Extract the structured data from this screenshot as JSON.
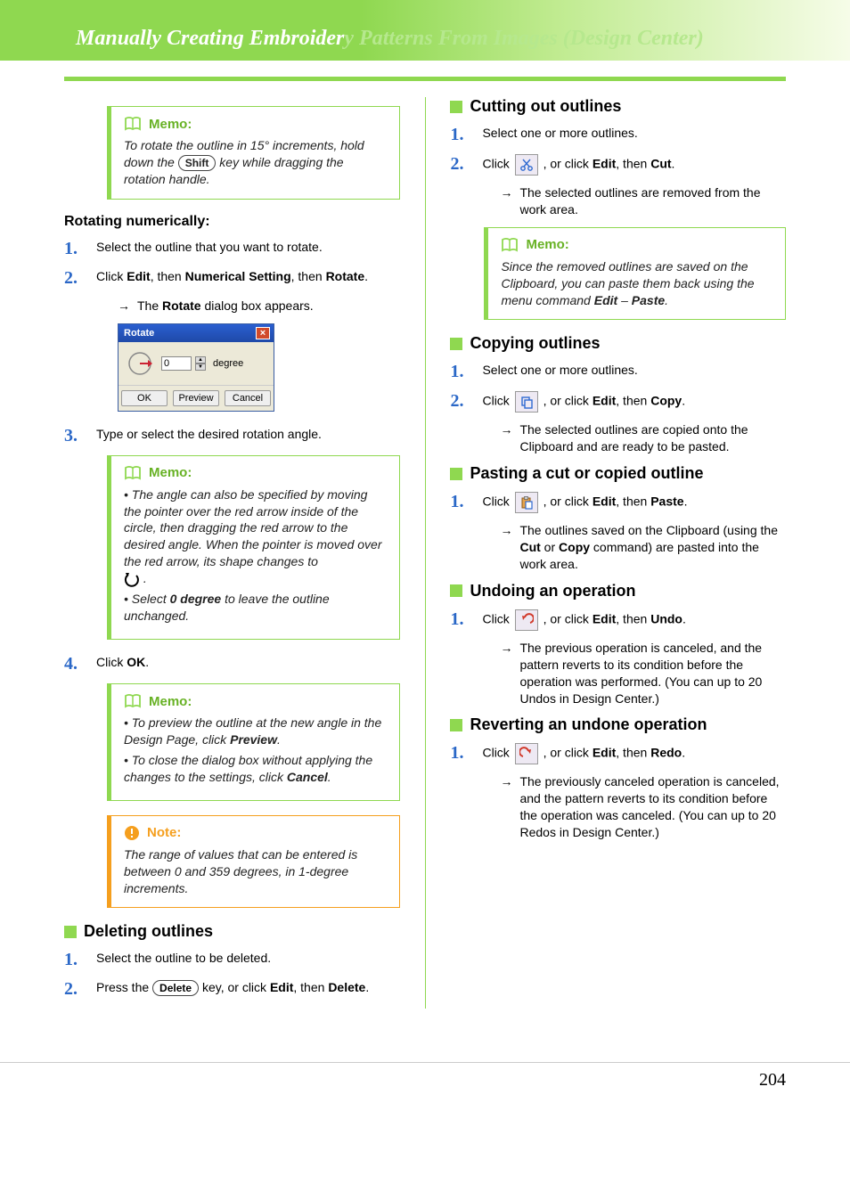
{
  "header": {
    "title_white": "Manually Creating Embroider",
    "title_fade": "y Patterns From Images (Design Center)"
  },
  "left": {
    "memo1": {
      "label": "Memo:",
      "text_a": "To rotate the outline in 15° increments, hold down the ",
      "shift": "Shift",
      "text_b": " key while dragging the rotation handle."
    },
    "rotnum_heading": "Rotating numerically:",
    "step1": "Select the outline that you want to rotate.",
    "step2_a": "Click ",
    "step2_edit": "Edit",
    "step2_b": ", then ",
    "step2_ns": "Numerical Setting",
    "step2_c": ", then ",
    "step2_rot": "Rotate",
    "step2_d": ".",
    "result2_a": "The ",
    "result2_b": "Rotate",
    "result2_c": " dialog box appears.",
    "dialog": {
      "title": "Rotate",
      "value": "0",
      "unit": "degree",
      "ok": "OK",
      "preview": "Preview",
      "cancel": "Cancel"
    },
    "step3": "Type or select the desired rotation angle.",
    "memo2": {
      "label": "Memo:",
      "li1": "The angle can also be specified by moving the pointer over the red arrow inside of the circle, then dragging the red arrow to the desired angle. When the pointer is moved over the red arrow, its shape changes to",
      "li1_suffix": ".",
      "li2_a": "Select ",
      "li2_b": "0 degree",
      "li2_c": " to leave the outline unchanged."
    },
    "step4_a": "Click ",
    "step4_b": "OK",
    "step4_c": ".",
    "memo3": {
      "label": "Memo:",
      "li1_a": "To preview the outline at the new angle in the Design Page, click ",
      "li1_b": "Preview",
      "li1_c": ".",
      "li2_a": "To close the dialog box without applying the changes to the settings, click ",
      "li2_b": "Cancel",
      "li2_c": "."
    },
    "note": {
      "label": "Note:",
      "text": "The range of values that can be entered is between 0 and 359 degrees, in 1-degree increments."
    },
    "del_heading": "Deleting outlines",
    "del_step1": "Select the outline to be deleted.",
    "del_step2_a": "Press the ",
    "del_step2_key": "Delete",
    "del_step2_b": " key, or click ",
    "del_step2_edit": "Edit",
    "del_step2_c": ", then ",
    "del_step2_del": "Delete",
    "del_step2_d": "."
  },
  "right": {
    "cut_heading": "Cutting out outlines",
    "cut_step1": "Select one or more outlines.",
    "cut_step2_a": "Click ",
    "cut_step2_b": " , or click ",
    "cut_step2_edit": "Edit",
    "cut_step2_c": ", then ",
    "cut_step2_cut": "Cut",
    "cut_step2_d": ".",
    "cut_result": "The selected outlines are removed from the work area.",
    "cut_memo": {
      "label": "Memo:",
      "text_a": "Since the removed outlines are saved on the Clipboard, you can paste them back using the menu command ",
      "edit": "Edit",
      "dash": " – ",
      "paste": "Paste",
      "text_b": "."
    },
    "copy_heading": "Copying outlines",
    "copy_step1": "Select one or more outlines.",
    "copy_step2_a": "Click ",
    "copy_step2_b": " , or click ",
    "copy_step2_edit": "Edit",
    "copy_step2_c": ", then ",
    "copy_step2_copy": "Copy",
    "copy_step2_d": ".",
    "copy_result": "The selected outlines are copied onto the Clipboard and are ready to be pasted.",
    "paste_heading": "Pasting a cut or copied outline",
    "paste_step1_a": "Click ",
    "paste_step1_b": " , or click ",
    "paste_step1_edit": "Edit",
    "paste_step1_c": ", then ",
    "paste_step1_paste": "Paste",
    "paste_step1_d": ".",
    "paste_result_a": "The outlines saved on the Clipboard (using the ",
    "paste_result_cut": "Cut",
    "paste_result_b": " or ",
    "paste_result_copy": "Copy",
    "paste_result_c": " command) are pasted into the work area.",
    "undo_heading": "Undoing an operation",
    "undo_step1_a": "Click ",
    "undo_step1_b": " , or click ",
    "undo_step1_edit": "Edit",
    "undo_step1_c": ", then ",
    "undo_step1_undo": "Undo",
    "undo_step1_d": ".",
    "undo_result": "The previous operation is canceled, and the pattern reverts to its condition before the operation was performed. (You can up to 20 Undos in Design Center.)",
    "redo_heading": "Reverting an undone operation",
    "redo_step1_a": "Click ",
    "redo_step1_b": " , or click ",
    "redo_step1_edit": "Edit",
    "redo_step1_c": ", then ",
    "redo_step1_redo": "Redo",
    "redo_step1_d": ".",
    "redo_result": "The previously canceled operation is canceled, and the pattern reverts to its condition before the operation was canceled. (You can up to 20 Redos in Design Center.)"
  },
  "page_number": "204"
}
